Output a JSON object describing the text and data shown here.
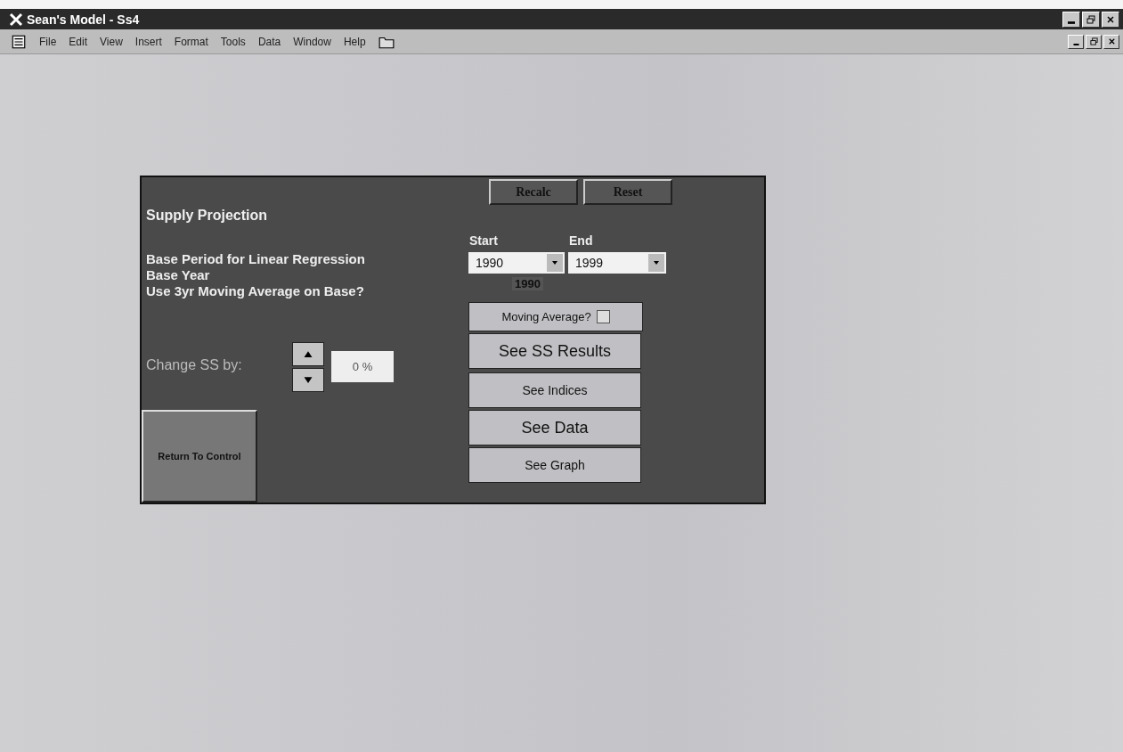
{
  "window": {
    "title": "Sean's Model - Ss4"
  },
  "menu_bar": {
    "items": [
      "File",
      "Edit",
      "View",
      "Insert",
      "Format",
      "Tools",
      "Data",
      "Window",
      "Help"
    ]
  },
  "form": {
    "title": "Supply Projection",
    "buttons_top": [
      "Recalc",
      "Reset"
    ],
    "base_period": {
      "label": "Base Period for Linear Regression",
      "start_label": "Start",
      "end_label": "End",
      "start_value": "1990",
      "end_value": "1999"
    },
    "base_year": {
      "label": "Base Year",
      "value": "1990"
    },
    "moving_average": {
      "label": "Use 3yr Moving Average on Base?",
      "checkbox_label": "Moving Average?",
      "checked": false
    },
    "change": {
      "label": "Change SS by:",
      "value": "0 %"
    },
    "nav_buttons": [
      "See SS Results",
      "See Indices",
      "See Data",
      "See Graph"
    ],
    "return_button": "Return To Control"
  }
}
